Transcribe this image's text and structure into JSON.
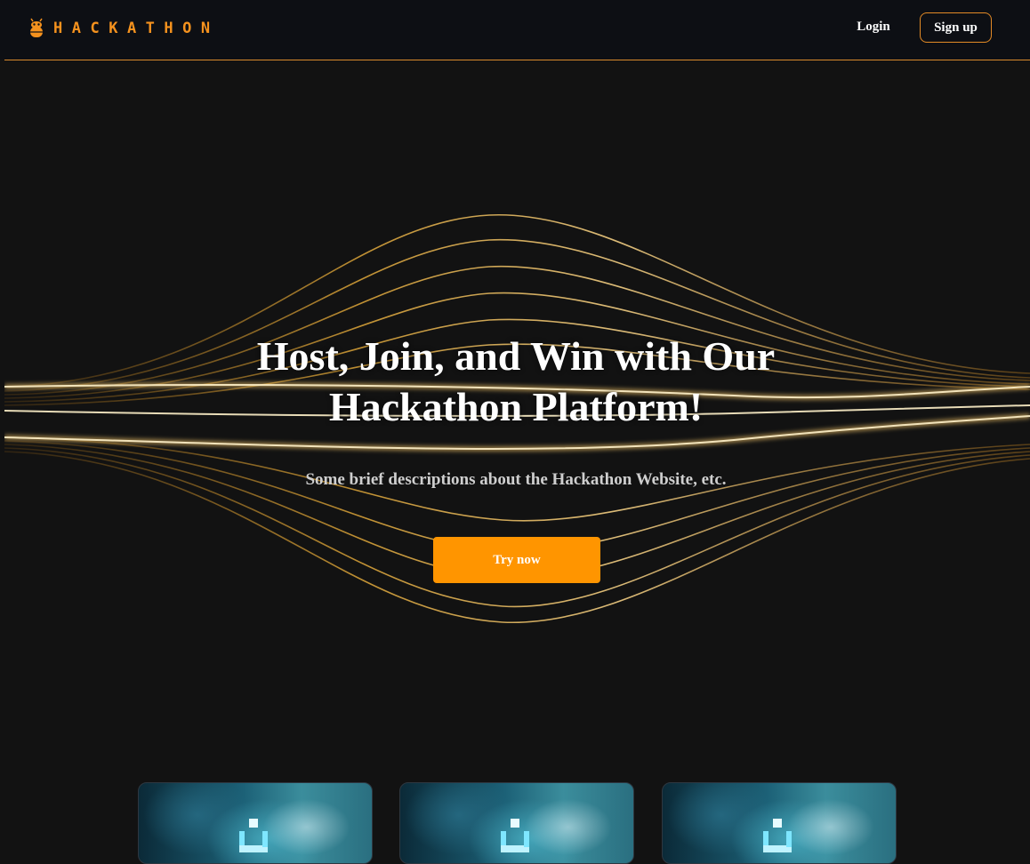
{
  "colors": {
    "background": "#121212",
    "navbar": "#0d0f14",
    "accent": "#ff9500",
    "brand": "#f5921e"
  },
  "navbar": {
    "brand": "HACKATHON",
    "brand_icon": "bug-icon",
    "login_label": "Login",
    "signup_label": "Sign up"
  },
  "hero": {
    "title_line1": "Host, Join, and Win with Our",
    "title_line2": "Hackathon Platform!",
    "description": "Some brief descriptions about the Hackathon Website, etc.",
    "cta_label": "Try now",
    "background": "golden-light-waves"
  },
  "cards": [
    {
      "image": "teal-abstract-thumbnail",
      "icon": "cube-logo-icon"
    },
    {
      "image": "teal-abstract-thumbnail",
      "icon": "cube-logo-icon"
    },
    {
      "image": "teal-abstract-thumbnail",
      "icon": "cube-logo-icon"
    }
  ]
}
